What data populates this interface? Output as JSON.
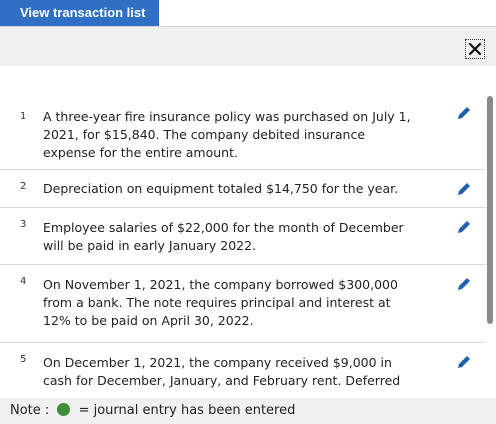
{
  "header": {
    "tab_label": "View transaction list"
  },
  "transactions": [
    {
      "number": "1",
      "text": "A three-year fire insurance policy was purchased on July 1, 2021, for $15,840. The company debited insurance expense for the entire amount."
    },
    {
      "number": "2",
      "text": "Depreciation on equipment totaled $14,750 for the year."
    },
    {
      "number": "3",
      "text": "Employee salaries of $22,000 for the month of December will be paid in early January 2022."
    },
    {
      "number": "4",
      "text": "On November 1, 2021, the company borrowed $300,000 from a bank. The note requires principal and interest at 12% to be paid on April 30, 2022."
    },
    {
      "number": "5",
      "text": "On December 1, 2021, the company received $9,000 in cash for December, January, and February rent. Deferred rent revenue was credited."
    }
  ],
  "note": {
    "prefix": "Note :",
    "suffix": "= journal entry has been entered",
    "dot_color": "#3f8f3a"
  },
  "icons": {
    "close": "close-icon",
    "edit": "pencil-icon"
  },
  "colors": {
    "accent": "#2f6fc4",
    "edit_icon": "#1f5fae"
  }
}
